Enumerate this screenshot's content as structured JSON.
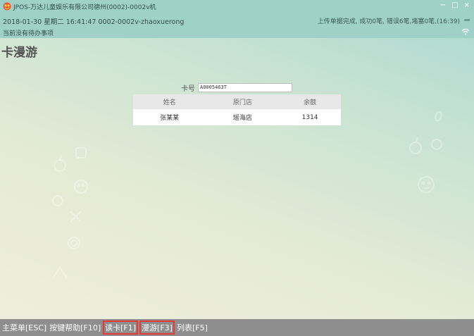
{
  "window": {
    "title": "JPOS-万达儿童娱乐有限公司德州(0002)-0002v机",
    "controls": {
      "minimize": "−",
      "maximize": "□",
      "close": "×"
    },
    "icons": {
      "logo": "app-logo-icon",
      "wifi": "wifi-icon"
    }
  },
  "info": {
    "datetime": "2018-01-30 星期二 16:41:47 0002-0002v-zhaoxuerong",
    "upload_status": "上传单据完成, 成功0笔, 错误6笔,堵塞0笔,(16:39)",
    "pending": "当前没有待办事项"
  },
  "page": {
    "title": "卡漫游"
  },
  "card": {
    "label": "卡号",
    "value": "A0005463T"
  },
  "member_table": {
    "columns": [
      "姓名",
      "原门店",
      "余额"
    ],
    "rows": [
      [
        "张某某",
        "瑶海店",
        "1314"
      ]
    ]
  },
  "fkeys": [
    {
      "label": "主菜单[ESC]",
      "highlighted": false
    },
    {
      "label": "按键帮助[F10]",
      "highlighted": false
    },
    {
      "label": "读卡[F1]",
      "highlighted": true
    },
    {
      "label": "漫游[F3]",
      "highlighted": true
    },
    {
      "label": "列表[F5]",
      "highlighted": false
    }
  ],
  "colors": {
    "header_bg": "#9fd1c9",
    "footer_bg": "#8e8e8e",
    "highlight_border": "#e53935"
  }
}
